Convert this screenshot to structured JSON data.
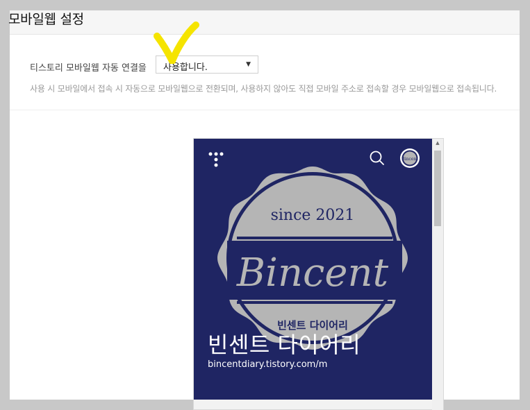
{
  "page": {
    "title": "모바일웹 설정"
  },
  "setting": {
    "label": "티스토리 모바일웹 자동 연결을",
    "selected": "사용합니다.",
    "help": "사용 시 모바일에서 접속 시 자동으로 모바일웹으로 전환되며, 사용하지 않아도 직접 모바일 주소로 접속할 경우 모바일웹으로 접속됩니다."
  },
  "preview": {
    "logo": {
      "top": "since 2021",
      "main": "Bincent",
      "bottom": "빈센트 다이어리",
      "avatar": "Bincent"
    },
    "blog_title": "빈센트 다이어리",
    "blog_url": "bincentdiary.tistory.com/m"
  },
  "icons": {
    "menu": "tistory-dots-icon",
    "search": "search-icon",
    "avatar": "avatar",
    "dropdown": "chevron-down-icon",
    "scroll_up": "scroll-up-arrow-icon"
  },
  "colors": {
    "preview_bg": "#1f2563",
    "seal": "#b5b5b5",
    "highlight": "#f5e400"
  }
}
